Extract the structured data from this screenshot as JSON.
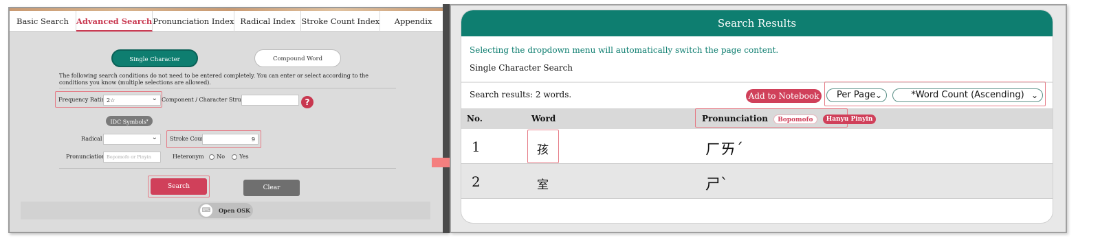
{
  "left": {
    "tabs": [
      "Basic Search",
      "Advanced Search",
      "Pronunciation Index",
      "Radical Index",
      "Stroke Count Index",
      "Appendix"
    ],
    "toggle_single": "Single Character",
    "toggle_compound": "Compound Word",
    "note": "The following search conditions do not need to be entered completely. You can enter or select according to the conditions you know (multiple selections are allowed).",
    "frequency_label": "Frequency Rating",
    "frequency_value": "2☆",
    "component_label": "Component / Character Structure",
    "help_symbol": "?",
    "idc_label": "IDC Symbols",
    "radical_label": "Radical",
    "stroke_label": "Stroke Count",
    "stroke_value": "9",
    "pronunciation_label": "Pronunciation",
    "pronunciation_placeholder": "Bopomofo or Pinyin",
    "heteronym_label": "Heteronym",
    "heteronym_no": "No",
    "heteronym_yes": "Yes",
    "search_button": "Search",
    "clear_button": "Clear",
    "osk_button": "Open OSK",
    "osk_icon": "keyboard-icon"
  },
  "right": {
    "header": "Search Results",
    "hint": "Selecting the dropdown menu will automatically switch the page content.",
    "mode": "Single Character Search",
    "count": "Search results: 2 words.",
    "add_notebook": "Add to Notebook",
    "per_page": "Per Page",
    "sort": "*Word Count (Ascending)",
    "columns": {
      "no": "No.",
      "word": "Word",
      "pronunciation": "Pronunciation"
    },
    "pill_bopomofo": "Bopomofo",
    "pill_pinyin": "Hanyu Pinyin",
    "rows": [
      {
        "no": "1",
        "word": "孩",
        "pron": "ㄏㄞˊ"
      },
      {
        "no": "2",
        "word": "室",
        "pron": "ㄕˋ"
      }
    ]
  },
  "colors": {
    "teal": "#0e7e70",
    "red": "#d0405a",
    "highlight": "#e57a85"
  }
}
